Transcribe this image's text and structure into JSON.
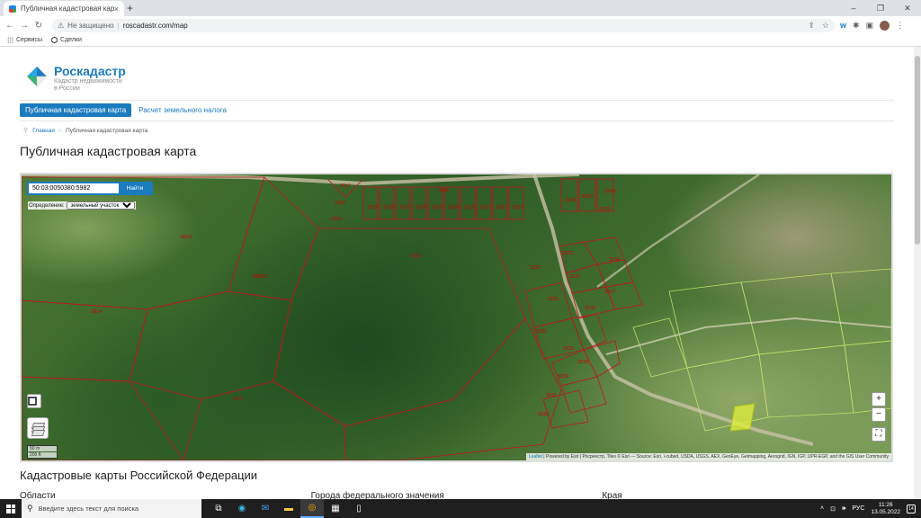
{
  "browser": {
    "tab_title": "Публичная кадастровая карта",
    "tab_close": "×",
    "new_tab": "+",
    "security": "Не защищено",
    "url": "roscadastr.com/map",
    "bookmarks": [
      "Сервисы",
      "Сделки"
    ],
    "profile_letter": "C",
    "window_controls": [
      "–",
      "❐",
      "✕"
    ]
  },
  "site": {
    "brand": "Роскадастр",
    "brand_sub_1": "Кадастр недвижимости",
    "brand_sub_2": "в России",
    "nav": [
      "Публичная кадастровая карта",
      "Расчет земельного налога"
    ],
    "breadcrumb": [
      "Главная",
      "Публичная кадастровая карта"
    ],
    "heading": "Публичная кадастровая карта",
    "section_heading": "Кадастровые карты Российской Федерации",
    "columns": [
      "Области",
      "Города федерального значения",
      "Края"
    ]
  },
  "map": {
    "search_value": "50:03:0050380:5982",
    "search_button": "Найти",
    "definition_label": "Определение:",
    "definition_value": "земельный участок",
    "zoom_in": "+",
    "zoom_out": "−",
    "scale_m": "50 m",
    "scale_ft": "200 ft",
    "attribution_leaflet": "Leaflet",
    "attribution_rest": " | Powered by Esri | Росреестр, Tiles © Esri — Source: Esri, i-cubed, USDA, USGS, AEX, GeoEye, Getmapping, Aerogrid, IGN, IGP, UPR-EGP, and the GIS User Community",
    "plot_labels": [
      "3117",
      "3258",
      "3118",
      "3119",
      "6814",
      "4111",
      "3223",
      "3222",
      "3221",
      "3235",
      "3226",
      "3229",
      "3230",
      "3231",
      "3232",
      "3988/2",
      "6814",
      "661",
      "3233",
      "3234",
      "3225",
      "3228",
      "3227",
      "3220",
      "3219",
      "3218",
      "3217",
      "3216",
      "3215",
      "3214",
      "3213",
      "3212",
      "3211",
      "3210",
      "3209",
      "3208"
    ]
  },
  "taskbar": {
    "search_placeholder": "Введите здесь текст для поиска",
    "lang": "РУС",
    "time": "11:26",
    "date": "13.05.2022",
    "notif_count": "14"
  },
  "colors": {
    "accent": "#1b7bbf",
    "parcel_line": "#c0151b"
  }
}
